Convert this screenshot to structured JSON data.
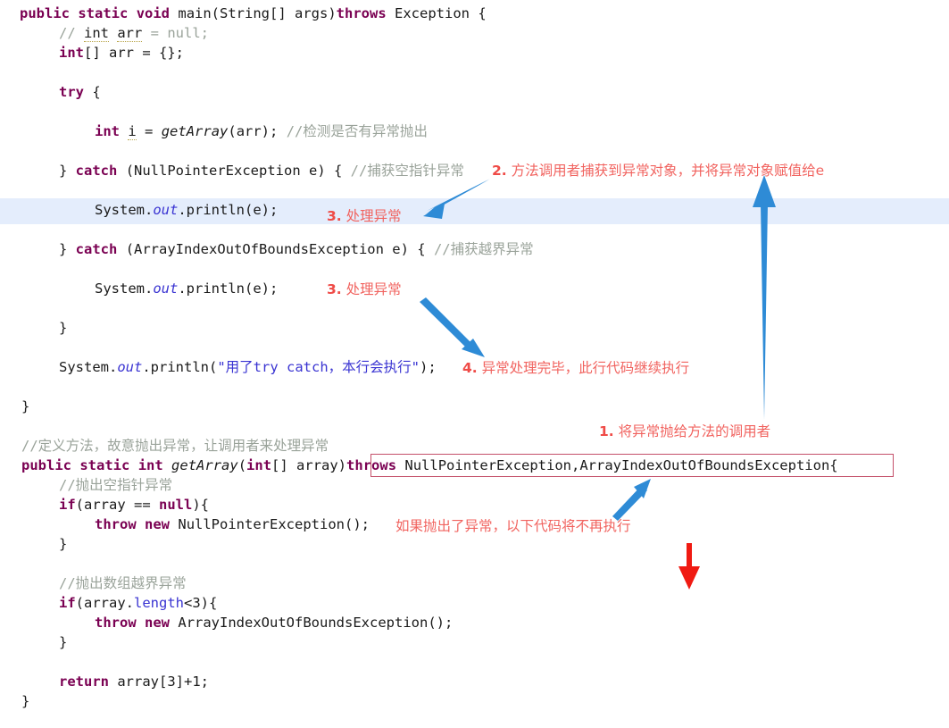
{
  "editor": {
    "background": "#ffffff",
    "highlight_line_color": "#e4edfc",
    "keyword_color": "#7a0052",
    "comment_color": "#9aa39a",
    "string_color": "#3a34d2",
    "annotation_color": "#f1635f",
    "arrow_blue": "#2e8bd6",
    "arrow_red": "#f01a12",
    "box_border": "#c4506a"
  },
  "code": {
    "lines": [
      {
        "id": "l01",
        "text": "public static void main(String[] args)throws Exception {"
      },
      {
        "id": "l02",
        "text": "    // int arr = null;"
      },
      {
        "id": "l03",
        "text": "    int[] arr = {};"
      },
      {
        "id": "l04",
        "text": ""
      },
      {
        "id": "l05",
        "text": "    try {"
      },
      {
        "id": "l06",
        "text": ""
      },
      {
        "id": "l07",
        "text": "        int i = getArray(arr); //检测是否有异常抛出"
      },
      {
        "id": "l08",
        "text": ""
      },
      {
        "id": "l09",
        "text": "    } catch (NullPointerException e) { //捕获空指针异常"
      },
      {
        "id": "l10",
        "text": ""
      },
      {
        "id": "l11",
        "text": "        System.out.println(e);"
      },
      {
        "id": "l12",
        "text": ""
      },
      {
        "id": "l13",
        "text": "    } catch (ArrayIndexOutOfBoundsException e) { //捕获越界异常"
      },
      {
        "id": "l14",
        "text": ""
      },
      {
        "id": "l15",
        "text": "        System.out.println(e);"
      },
      {
        "id": "l16",
        "text": ""
      },
      {
        "id": "l17",
        "text": "    }"
      },
      {
        "id": "l18",
        "text": ""
      },
      {
        "id": "l19",
        "text": "    System.out.println(\"用了try catch，本行会执行\");"
      },
      {
        "id": "l20",
        "text": ""
      },
      {
        "id": "l21",
        "text": "}"
      },
      {
        "id": "l22",
        "text": ""
      },
      {
        "id": "l23",
        "text": "//定义方法，故意抛出异常，让调用者来处理异常"
      },
      {
        "id": "l24",
        "text": "public static int getArray(int[] array)throws NullPointerException,ArrayIndexOutOfBoundsException{"
      },
      {
        "id": "l25",
        "text": "    //抛出空指针异常"
      },
      {
        "id": "l26",
        "text": "    if(array == null){"
      },
      {
        "id": "l27",
        "text": "        throw new NullPointerException();"
      },
      {
        "id": "l28",
        "text": "    }"
      },
      {
        "id": "l29",
        "text": ""
      },
      {
        "id": "l30",
        "text": "    //抛出数组越界异常"
      },
      {
        "id": "l31",
        "text": "    if(array.length<3){"
      },
      {
        "id": "l32",
        "text": "        throw new ArrayIndexOutOfBoundsException();"
      },
      {
        "id": "l33",
        "text": "    }"
      },
      {
        "id": "l34",
        "text": ""
      },
      {
        "id": "l35",
        "text": "    return array[3]+1;"
      },
      {
        "id": "l36",
        "text": "}"
      }
    ]
  },
  "annotations": {
    "note1": {
      "num": "1.",
      "text": " 将异常抛给方法的调用者"
    },
    "note2": {
      "num": "2.",
      "text": " 方法调用者捕获到异常对象，并将异常对象赋值给e"
    },
    "note3a": {
      "num": "3.",
      "text": " 处理异常"
    },
    "note3b": {
      "num": "3.",
      "text": " 处理异常"
    },
    "note4": {
      "num": "4.",
      "text": " 异常处理完毕，此行代码继续执行"
    },
    "note5": {
      "num": "",
      "text": "如果抛出了异常，以下代码将不再执行"
    }
  }
}
